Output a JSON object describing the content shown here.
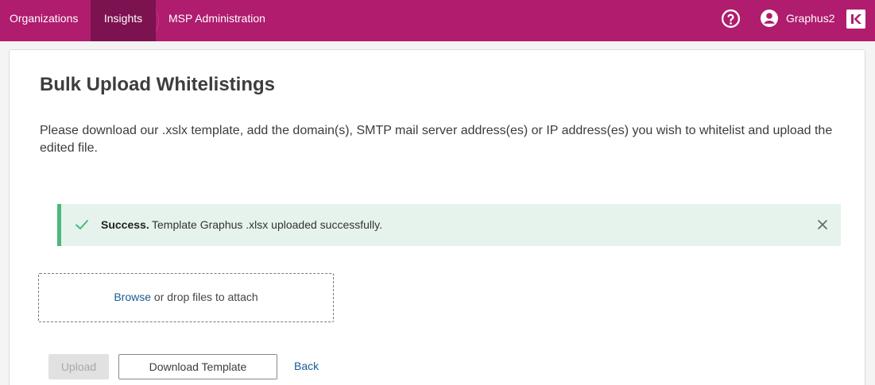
{
  "nav": {
    "items": [
      {
        "label": "Organizations"
      },
      {
        "label": "Insights",
        "active": true
      },
      {
        "label": "MSP Administration"
      }
    ],
    "help_icon": "question-circle-icon",
    "user_icon": "user-circle-icon",
    "user_name": "Graphus2",
    "brand_icon": "kaseya-logo-icon",
    "accent_color": "#b01c6e",
    "active_color": "#7d1250"
  },
  "page": {
    "title": "Bulk Upload Whitelistings",
    "description": "Please download our .xslx template, add the domain(s), SMTP mail server address(es) or IP address(es) you wish to whitelist and upload the edited file."
  },
  "alert": {
    "icon": "check-icon",
    "strong": "Success.",
    "message": "Template Graphus .xlsx uploaded successfully.",
    "close_icon": "close-icon",
    "color": "#4cb77a"
  },
  "dropzone": {
    "browse_label": "Browse",
    "text": " or drop files to attach"
  },
  "actions": {
    "upload_label": "Upload",
    "download_label": "Download Template",
    "back_label": "Back"
  }
}
